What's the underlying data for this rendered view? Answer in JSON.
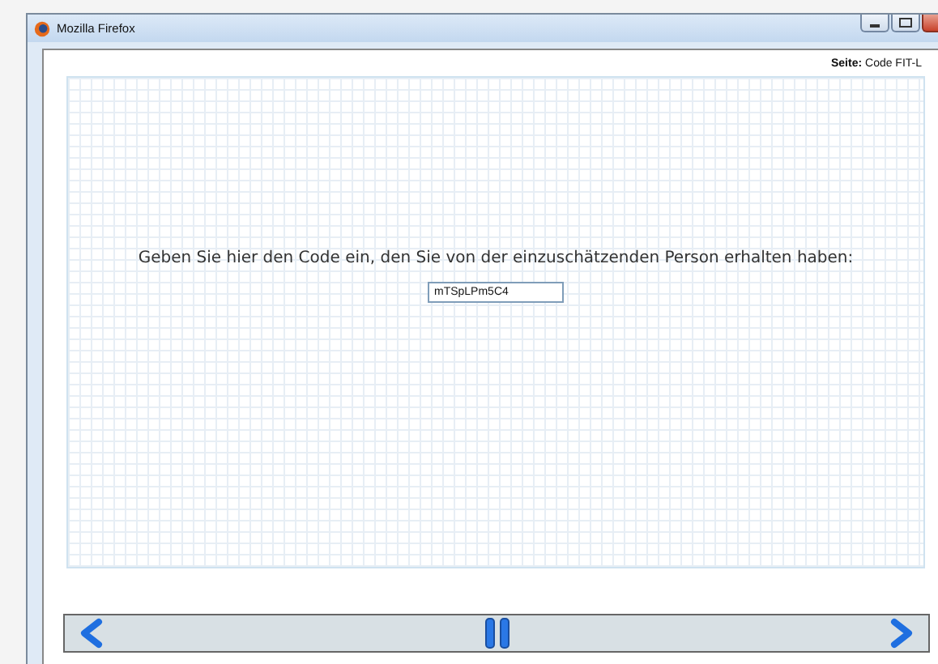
{
  "window": {
    "title": "Mozilla Firefox"
  },
  "page_label": {
    "label": "Seite:",
    "value": "Code FIT-L"
  },
  "prompt": "Geben Sie hier den Code ein, den Sie von der einzuschätzenden Person erhalten haben:",
  "code_field": {
    "value": "mTSpLPm5C4"
  },
  "nav": [
    {
      "kind": "back"
    },
    {
      "kind": "pause"
    },
    {
      "kind": "forward"
    }
  ]
}
